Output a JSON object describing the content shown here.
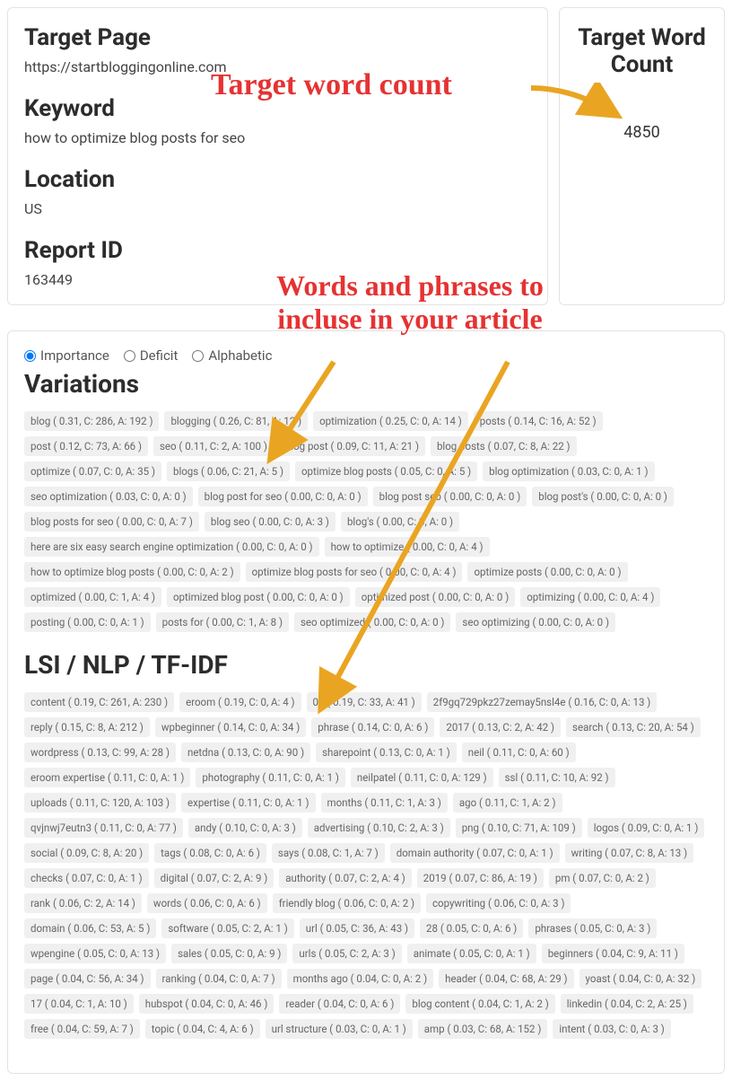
{
  "annotations": {
    "target_word_count": "Target word count",
    "words_phrases_line1": "Words and phrases to",
    "words_phrases_line2": "incluse in your article"
  },
  "left": {
    "target_page_label": "Target Page",
    "target_page_value": "https://startbloggingonline.com",
    "keyword_label": "Keyword",
    "keyword_value": "how to optimize blog posts for seo",
    "location_label": "Location",
    "location_value": "US",
    "report_id_label": "Report ID",
    "report_id_value": "163449"
  },
  "right": {
    "title": "Target Word Count",
    "value": "4850"
  },
  "sort": {
    "importance": "Importance",
    "deficit": "Deficit",
    "alphabetic": "Alphabetic"
  },
  "sections": {
    "variations_title": "Variations",
    "lsi_title": "LSI / NLP / TF-IDF"
  },
  "variations": [
    "blog ( 0.31, C: 286, A: 192 )",
    "blogging ( 0.26, C: 81, A: 12 )",
    "optimization ( 0.25, C: 0, A: 14 )",
    "posts ( 0.14, C: 16, A: 52 )",
    "post ( 0.12, C: 73, A: 66 )",
    "seo ( 0.11, C: 2, A: 100 )",
    "blog post ( 0.09, C: 11, A: 21 )",
    "blog posts ( 0.07, C: 8, A: 22 )",
    "optimize ( 0.07, C: 0, A: 35 )",
    "blogs ( 0.06, C: 21, A: 5 )",
    "optimize blog posts ( 0.05, C: 0, A: 5 )",
    "blog optimization ( 0.03, C: 0, A: 1 )",
    "seo optimization ( 0.03, C: 0, A: 0 )",
    "blog post for seo ( 0.00, C: 0, A: 0 )",
    "blog post seo ( 0.00, C: 0, A: 0 )",
    "blog post's ( 0.00, C: 0, A: 0 )",
    "blog posts for seo ( 0.00, C: 0, A: 7 )",
    "blog seo ( 0.00, C: 0, A: 3 )",
    "blog's ( 0.00, C: 3, A: 0 )",
    "here are six easy search engine optimization ( 0.00, C: 0, A: 0 )",
    "how to optimize ( 0.00, C: 0, A: 4 )",
    "how to optimize blog posts ( 0.00, C: 0, A: 2 )",
    "optimize blog posts for seo ( 0.00, C: 0, A: 4 )",
    "optimize posts ( 0.00, C: 0, A: 0 )",
    "optimized ( 0.00, C: 1, A: 4 )",
    "optimized blog post ( 0.00, C: 0, A: 0 )",
    "optimized post ( 0.00, C: 0, A: 0 )",
    "optimizing ( 0.00, C: 0, A: 4 )",
    "posting ( 0.00, C: 0, A: 1 )",
    "posts for ( 0.00, C: 1, A: 8 )",
    "seo optimized ( 0.00, C: 0, A: 0 )",
    "seo optimizing ( 0.00, C: 0, A: 0 )"
  ],
  "lsi": [
    "content ( 0.19, C: 261, A: 230 )",
    "eroom ( 0.19, C: 0, A: 4 )",
    "04 ( 0.19, C: 33, A: 41 )",
    "2f9gq729pkz27zemay5nsl4e ( 0.16, C: 0, A: 13 )",
    "reply ( 0.15, C: 8, A: 212 )",
    "wpbeginner ( 0.14, C: 0, A: 34 )",
    "phrase ( 0.14, C: 0, A: 6 )",
    "2017 ( 0.13, C: 2, A: 42 )",
    "search ( 0.13, C: 20, A: 54 )",
    "wordpress ( 0.13, C: 99, A: 28 )",
    "netdna ( 0.13, C: 0, A: 90 )",
    "sharepoint ( 0.13, C: 0, A: 1 )",
    "neil ( 0.11, C: 0, A: 60 )",
    "eroom expertise ( 0.11, C: 0, A: 1 )",
    "photography ( 0.11, C: 0, A: 1 )",
    "neilpatel ( 0.11, C: 0, A: 129 )",
    "ssl ( 0.11, C: 10, A: 92 )",
    "uploads ( 0.11, C: 120, A: 103 )",
    "expertise ( 0.11, C: 0, A: 1 )",
    "months ( 0.11, C: 1, A: 3 )",
    "ago ( 0.11, C: 1, A: 2 )",
    "qvjnwj7eutn3 ( 0.11, C: 0, A: 77 )",
    "andy ( 0.10, C: 0, A: 3 )",
    "advertising ( 0.10, C: 2, A: 3 )",
    "png ( 0.10, C: 71, A: 109 )",
    "logos ( 0.09, C: 0, A: 1 )",
    "social ( 0.09, C: 8, A: 20 )",
    "tags ( 0.08, C: 0, A: 6 )",
    "says ( 0.08, C: 1, A: 7 )",
    "domain authority ( 0.07, C: 0, A: 1 )",
    "writing ( 0.07, C: 8, A: 13 )",
    "checks ( 0.07, C: 0, A: 1 )",
    "digital ( 0.07, C: 2, A: 9 )",
    "authority ( 0.07, C: 2, A: 4 )",
    "2019 ( 0.07, C: 86, A: 19 )",
    "pm ( 0.07, C: 0, A: 2 )",
    "rank ( 0.06, C: 2, A: 14 )",
    "words ( 0.06, C: 0, A: 6 )",
    "friendly blog ( 0.06, C: 0, A: 2 )",
    "copywriting ( 0.06, C: 0, A: 3 )",
    "domain ( 0.06, C: 53, A: 5 )",
    "software ( 0.05, C: 2, A: 1 )",
    "url ( 0.05, C: 36, A: 43 )",
    "28 ( 0.05, C: 0, A: 6 )",
    "phrases ( 0.05, C: 0, A: 3 )",
    "wpengine ( 0.05, C: 0, A: 13 )",
    "sales ( 0.05, C: 0, A: 9 )",
    "urls ( 0.05, C: 2, A: 3 )",
    "animate ( 0.05, C: 0, A: 1 )",
    "beginners ( 0.04, C: 9, A: 11 )",
    "page ( 0.04, C: 56, A: 34 )",
    "ranking ( 0.04, C: 0, A: 7 )",
    "months ago ( 0.04, C: 0, A: 2 )",
    "header ( 0.04, C: 68, A: 29 )",
    "yoast ( 0.04, C: 0, A: 32 )",
    "17 ( 0.04, C: 1, A: 10 )",
    "hubspot ( 0.04, C: 0, A: 46 )",
    "reader ( 0.04, C: 0, A: 6 )",
    "blog content ( 0.04, C: 1, A: 2 )",
    "linkedin ( 0.04, C: 2, A: 25 )",
    "free ( 0.04, C: 59, A: 7 )",
    "topic ( 0.04, C: 4, A: 6 )",
    "url structure ( 0.03, C: 0, A: 1 )",
    "amp ( 0.03, C: 68, A: 152 )",
    "intent ( 0.03, C: 0, A: 3 )"
  ]
}
